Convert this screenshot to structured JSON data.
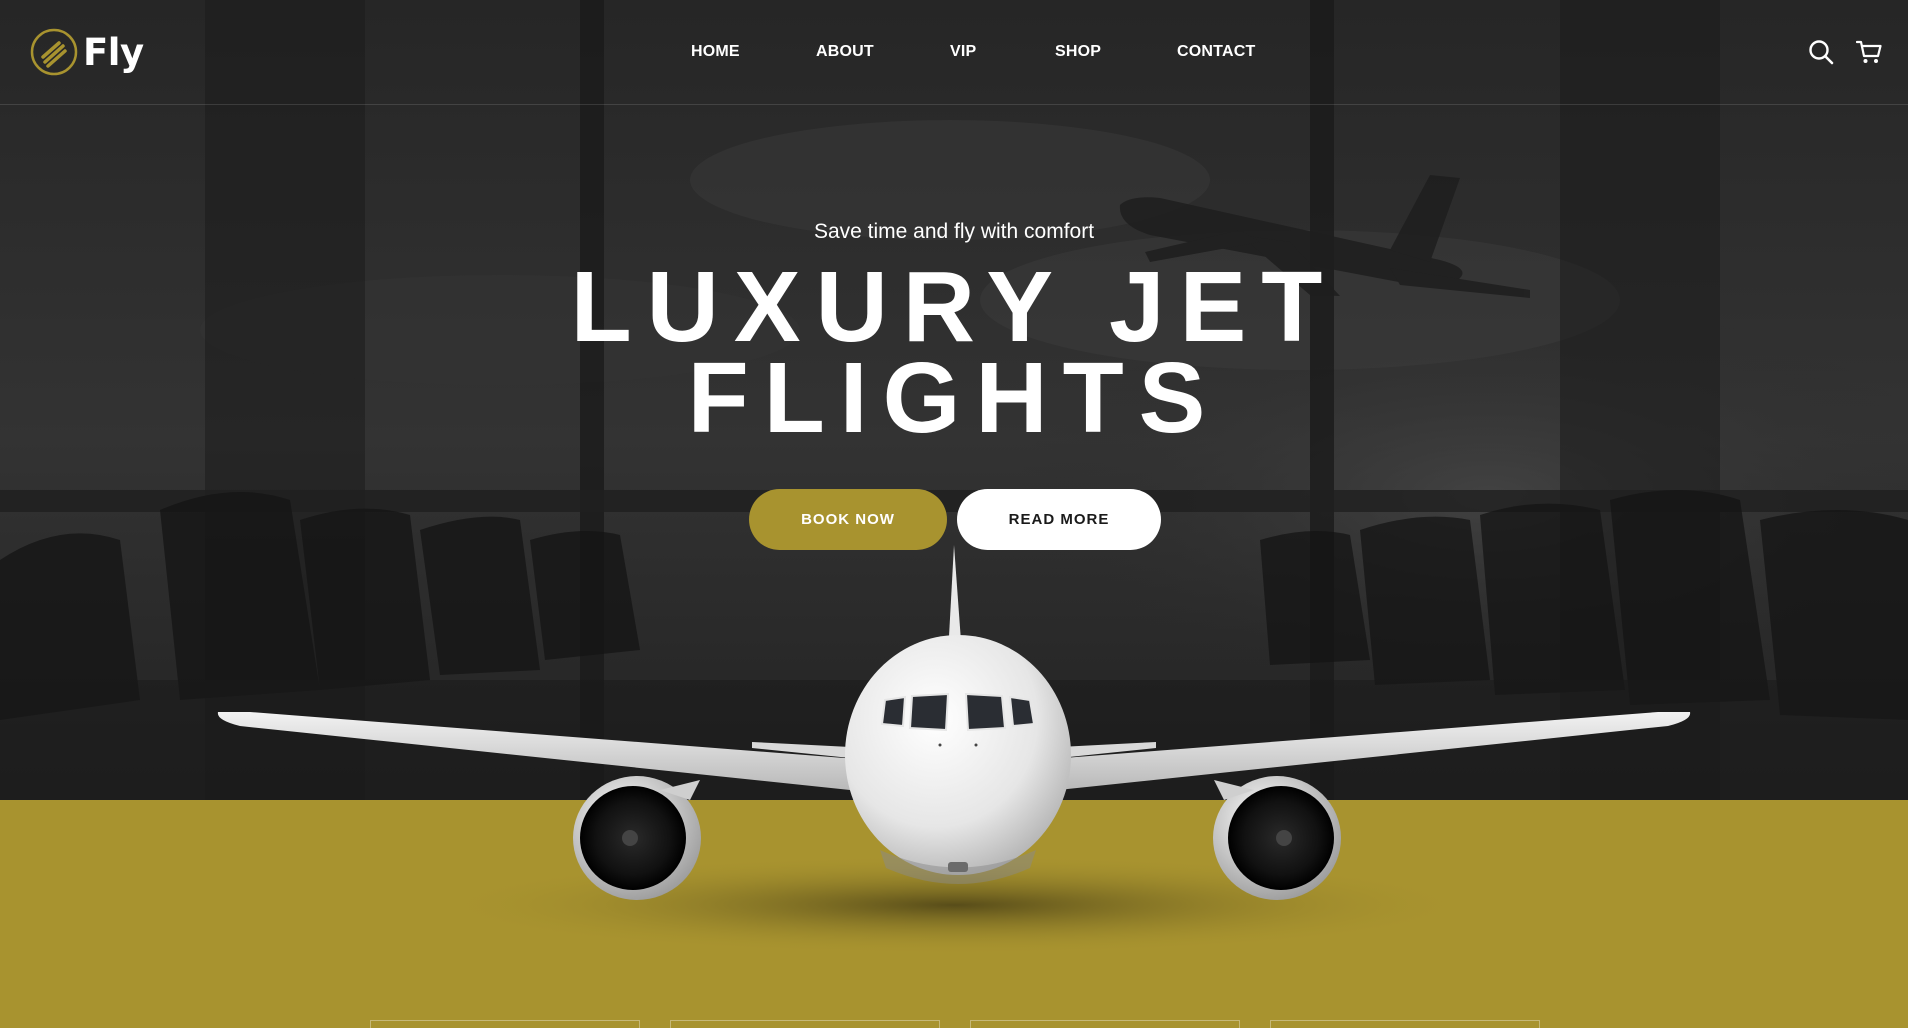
{
  "brand": {
    "name": "Fly",
    "accent_color": "#a8932f"
  },
  "nav": {
    "items": [
      {
        "label": "HOME"
      },
      {
        "label": "ABOUT"
      },
      {
        "label": "VIP"
      },
      {
        "label": "SHOP"
      },
      {
        "label": "CONTACT"
      }
    ]
  },
  "header_icons": [
    "search-icon",
    "cart-icon"
  ],
  "hero": {
    "tagline": "Save time and fly with comfort",
    "headline_line1": "LUXURY JET",
    "headline_line2": "FLIGHTS",
    "book_label": "BOOK NOW",
    "read_label": "READ MORE"
  }
}
